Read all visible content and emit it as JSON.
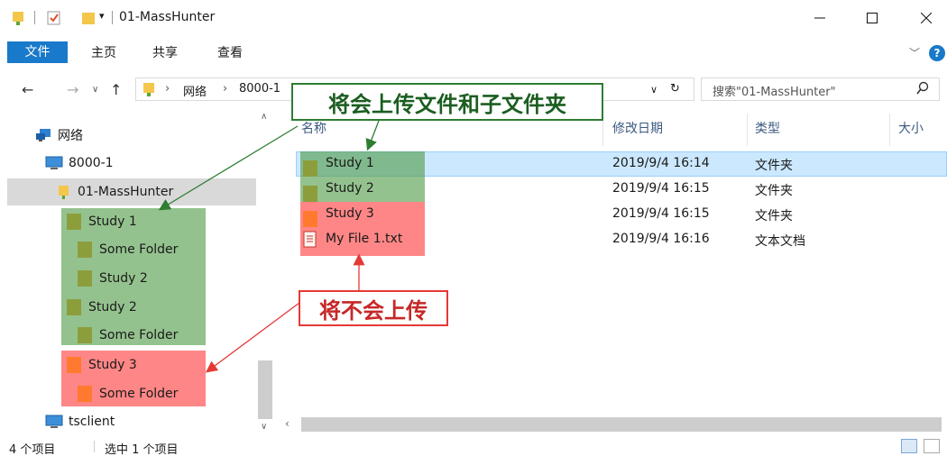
{
  "window": {
    "title": "01-MassHunter",
    "qa_dropdown": "▾"
  },
  "ribbon": {
    "tabs": [
      "文件",
      "主页",
      "共享",
      "查看"
    ]
  },
  "address": {
    "segments": [
      "网络",
      "8000-1"
    ],
    "search_placeholder": "搜索\"01-MassHunter\""
  },
  "nav_tree": [
    {
      "label": "网络"
    },
    {
      "label": "8000-1"
    },
    {
      "label": "01-MassHunter"
    },
    {
      "label": "Study 1"
    },
    {
      "label": "Some Folder"
    },
    {
      "label": "Study 2"
    },
    {
      "label": "Study 2"
    },
    {
      "label": "Some Folder"
    },
    {
      "label": "Study 3"
    },
    {
      "label": "Some Folder"
    },
    {
      "label": "tsclient"
    }
  ],
  "columns": [
    "名称",
    "修改日期",
    "类型",
    "大小"
  ],
  "files": [
    {
      "name": "Study 1",
      "date": "2019/9/4 16:14",
      "type": "文件夹"
    },
    {
      "name": "Study 2",
      "date": "2019/9/4 16:15",
      "type": "文件夹"
    },
    {
      "name": "Study 3",
      "date": "2019/9/4 16:15",
      "type": "文件夹"
    },
    {
      "name": "My File 1.txt",
      "date": "2019/9/4 16:16",
      "type": "文本文档"
    }
  ],
  "status": {
    "count": "4 个项目",
    "selected": "选中 1 个项目"
  },
  "annotations": {
    "will_upload": "将会上传文件和子文件夹",
    "will_not_upload": "将不会上传"
  },
  "colors": {
    "accent": "#1979ca",
    "green_highlight": "#4c9a42",
    "red_highlight": "#ff3c3c",
    "folder": "#f4c64a"
  }
}
